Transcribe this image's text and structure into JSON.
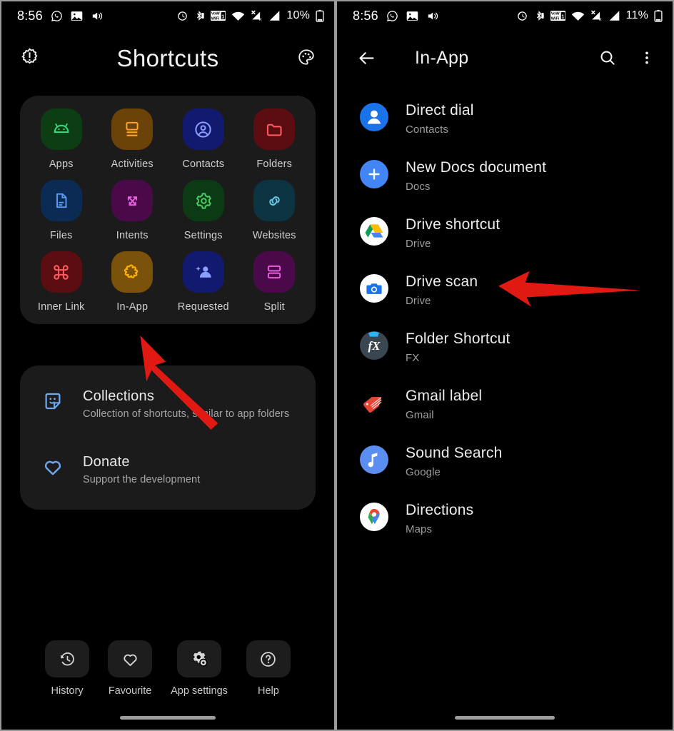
{
  "left": {
    "status": {
      "time": "8:56",
      "battery": "10%",
      "left_icons": [
        "whatsapp-icon",
        "image-icon",
        "volume-icon"
      ],
      "right_icons": [
        "alarm-icon",
        "bluetooth-icon",
        "volte-wifi-icon",
        "wifi-icon",
        "signal-muted-icon",
        "signal-icon",
        "battery-icon"
      ]
    },
    "header": {
      "title": "Shortcuts",
      "left_icon": "badge-alert-icon",
      "right_icon": "palette-icon"
    },
    "grid": [
      {
        "label": "Apps",
        "icon": "android-icon",
        "tile": "#0d3d12",
        "fg": "#3ddc84"
      },
      {
        "label": "Activities",
        "icon": "window-icon",
        "tile": "#6b4208",
        "fg": "#ffa726"
      },
      {
        "label": "Contacts",
        "icon": "account-icon",
        "tile": "#111a6e",
        "fg": "#8c9eff"
      },
      {
        "label": "Folders",
        "icon": "folder-icon",
        "tile": "#5c0d12",
        "fg": "#ff5a5f"
      },
      {
        "label": "Files",
        "icon": "file-icon",
        "tile": "#0b2a54",
        "fg": "#5b9bf8"
      },
      {
        "label": "Intents",
        "icon": "intent-icon",
        "tile": "#4a0a4a",
        "fg": "#e95fe0"
      },
      {
        "label": "Settings",
        "icon": "gear-icon",
        "tile": "#0c3a14",
        "fg": "#46d162"
      },
      {
        "label": "Websites",
        "icon": "link-icon",
        "tile": "#0c3442",
        "fg": "#69c7e0"
      },
      {
        "label": "Inner Link",
        "icon": "command-icon",
        "tile": "#5c0d12",
        "fg": "#ff5a5f"
      },
      {
        "label": "In-App",
        "icon": "puzzle-icon",
        "tile": "#7a5209",
        "fg": "#ffb300"
      },
      {
        "label": "Requested",
        "icon": "person-add-icon",
        "tile": "#111a6e",
        "fg": "#8c9eff"
      },
      {
        "label": "Split",
        "icon": "split-icon",
        "tile": "#4a0a4a",
        "fg": "#e95fe0"
      }
    ],
    "list": [
      {
        "title": "Collections",
        "subtitle": "Collection of shortcuts, similar to app folders",
        "icon": "sticker-icon"
      },
      {
        "title": "Donate",
        "subtitle": "Support the development",
        "icon": "heart-icon"
      }
    ],
    "bottom": [
      {
        "label": "History",
        "icon": "history-icon"
      },
      {
        "label": "Favourite",
        "icon": "heart-outline-icon"
      },
      {
        "label": "App settings",
        "icon": "app-settings-icon"
      },
      {
        "label": "Help",
        "icon": "help-circle-icon"
      }
    ]
  },
  "right": {
    "status": {
      "time": "8:56",
      "battery": "11%",
      "left_icons": [
        "whatsapp-icon",
        "image-icon",
        "volume-icon"
      ],
      "right_icons": [
        "alarm-icon",
        "bluetooth-icon",
        "volte-wifi-icon",
        "wifi-icon",
        "signal-muted-icon",
        "signal-icon",
        "battery-icon"
      ]
    },
    "appbar": {
      "back_icon": "back-arrow-icon",
      "title": "In-App",
      "search_icon": "search-icon",
      "overflow_icon": "more-vert-icon"
    },
    "items": [
      {
        "name": "Direct dial",
        "app": "Contacts",
        "icon": "contacts-person-icon"
      },
      {
        "name": "New Docs document",
        "app": "Docs",
        "icon": "docs-plus-icon"
      },
      {
        "name": "Drive shortcut",
        "app": "Drive",
        "icon": "google-drive-icon"
      },
      {
        "name": "Drive scan",
        "app": "Drive",
        "icon": "drive-scan-camera-icon"
      },
      {
        "name": "Folder Shortcut",
        "app": "FX",
        "icon": "fx-icon"
      },
      {
        "name": "Gmail label",
        "app": "Gmail",
        "icon": "gmail-label-tag-icon"
      },
      {
        "name": "Sound Search",
        "app": "Google",
        "icon": "music-note-icon"
      },
      {
        "name": "Directions",
        "app": "Maps",
        "icon": "google-maps-pin-icon"
      }
    ]
  },
  "annotations": {
    "arrow_color": "#e01a12",
    "left_arrow_target": "In-App grid tile",
    "right_arrow_target": "Drive shortcut list item"
  }
}
